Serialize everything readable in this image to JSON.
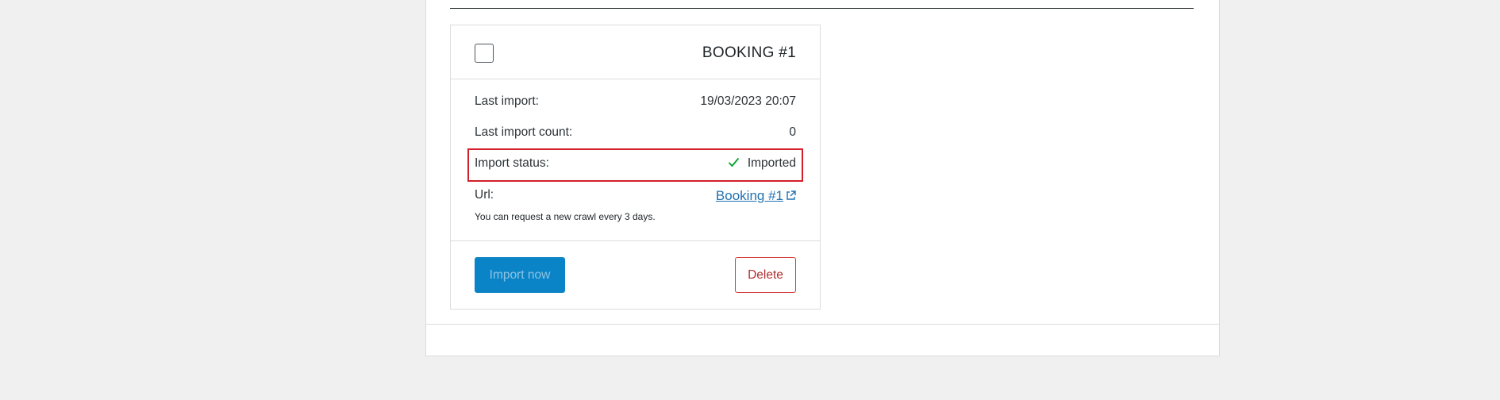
{
  "card": {
    "title": "BOOKING #1",
    "rows": {
      "last_import": {
        "label": "Last import:",
        "value": "19/03/2023 20:07"
      },
      "last_import_count": {
        "label": "Last import count:",
        "value": "0"
      },
      "import_status": {
        "label": "Import status:",
        "value": "Imported"
      },
      "url": {
        "label": "Url:",
        "link_text": "Booking #1"
      }
    },
    "note": "You can request a new crawl every 3 days.",
    "buttons": {
      "import_now": "Import now",
      "delete": "Delete"
    }
  },
  "icons": {
    "status": "check-icon",
    "link": "external-link-icon"
  },
  "colors": {
    "primary": "#0a84c6",
    "link": "#2271b1",
    "success": "#00a32a",
    "danger": "#d63638",
    "highlight": "#d21f2b"
  }
}
